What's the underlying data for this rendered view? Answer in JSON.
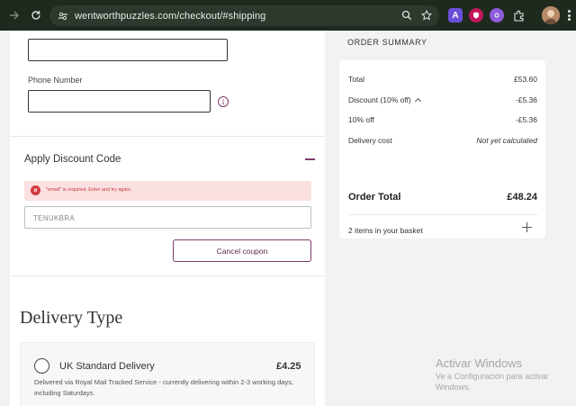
{
  "browser": {
    "url": "wentworthpuzzles.com/checkout/#shipping",
    "extension_a_label": "A"
  },
  "form": {
    "phone_label": "Phone Number",
    "info_glyph": "i"
  },
  "discount": {
    "title": "Apply Discount Code",
    "error_message": "\"email\" is required. Enter and try again.",
    "code_value": "TENUKBRA",
    "cancel_label": "Cancel coupon"
  },
  "delivery": {
    "heading": "Delivery Type",
    "option_name": "UK Standard Delivery",
    "option_price": "£4.25",
    "option_description": "Delivered via Royal Mail Tracked Service - currently delivering within 2-3 working days, including Saturdays."
  },
  "summary": {
    "title": "ORDER SUMMARY",
    "rows": [
      {
        "label": "Total",
        "value": "£53.60"
      },
      {
        "label": "Discount (10% off)",
        "value": "-£5.36"
      },
      {
        "label": "10% off",
        "value": "-£5.36"
      },
      {
        "label": "Delivery cost",
        "value": "Not yet calculated"
      }
    ],
    "order_total_label": "Order Total",
    "order_total_value": "£48.24",
    "items_label": "2 items in your basket"
  },
  "watermark": {
    "title": "Activar Windows",
    "subtitle": "Ve a Configuración para activar Windows."
  },
  "colors": {
    "accent": "#7a3b6a",
    "error": "#d23a3f",
    "error_bg": "#fbe0e1",
    "chrome_bg": "#1f2a1f"
  },
  "icons": [
    "back-icon",
    "forward-icon",
    "reload-icon",
    "site-info-icon",
    "zoom-icon",
    "bookmark-star-icon",
    "extensions-icon",
    "menu-icon",
    "info-icon",
    "minus-icon",
    "error-icon",
    "plus-icon",
    "chevron-up-icon",
    "radio-icon"
  ]
}
